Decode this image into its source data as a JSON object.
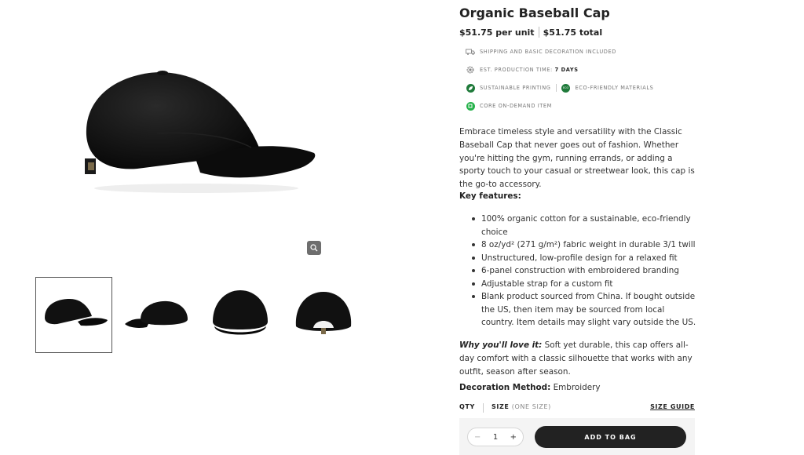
{
  "product": {
    "title": "Organic Baseball Cap",
    "price_unit": "$51.75 per unit",
    "price_total": "$51.75 total"
  },
  "features": {
    "shipping": "Shipping and basic decoration included",
    "production_label": "Est. production time:",
    "production_value": "7 days",
    "sustainable": "Sustainable printing",
    "eco": "Eco-friendly materials",
    "core": "Core on-demand item"
  },
  "description": "Embrace timeless style and versatility with the Classic Baseball Cap that never goes out of fashion. Whether you're hitting the gym, running errands, or adding a sporty touch to your casual or streetwear look, this cap is the go-to accessory.",
  "key_features_label": "Key features:",
  "key_features": [
    "100% organic cotton for a sustainable, eco-friendly choice",
    "8 oz/yd² (271 g/m²) fabric weight in durable 3/1 twill",
    "Unstructured, low-profile design for a relaxed fit",
    "6-panel construction with embroidered branding",
    "Adjustable strap for a custom fit",
    "Blank product sourced from China. If bought outside the US, then item may be sourced from local country. Item details may slight vary outside the US."
  ],
  "why_label": "Why you'll love it:",
  "why_text": " Soft yet durable, this cap offers all-day comfort with a classic silhouette that works with any outfit, season after season.",
  "decoration_label": "Decoration Method:",
  "decoration_value": " Embroidery",
  "options": {
    "qty_label": "QTY",
    "size_label": "SIZE",
    "size_value": "(ONE SIZE)",
    "size_guide": "SIZE GUIDE"
  },
  "cart": {
    "quantity": "1",
    "minus": "−",
    "plus": "+",
    "add_label": "ADD TO BAG"
  },
  "icons": [
    "truck-icon",
    "gear-icon",
    "leaf-icon",
    "eco-icon",
    "core-icon",
    "zoom-icon"
  ],
  "colors": {
    "accent": "#222222",
    "eco_green": "#1f7a3a",
    "core_green": "#25b24a"
  }
}
